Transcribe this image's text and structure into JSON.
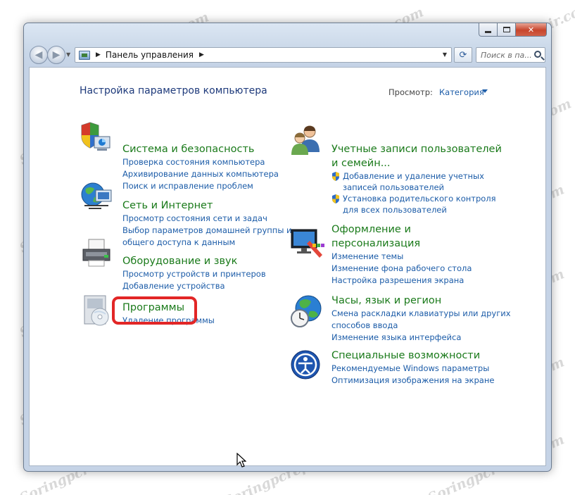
{
  "window": {
    "controls": {
      "minimize": "minimize",
      "maximize": "maximize",
      "close": "✕"
    }
  },
  "address": {
    "crumb": "Панель управления",
    "search_placeholder": "Поиск в па..."
  },
  "header": {
    "title": "Настройка параметров компьютера",
    "view_label": "Просмотр:",
    "view_value": "Категория"
  },
  "left": [
    {
      "title": "Система и безопасность",
      "icon": "shield-computer-icon",
      "links": [
        "Проверка состояния компьютера",
        "Архивирование данных компьютера",
        "Поиск и исправление проблем"
      ]
    },
    {
      "title": "Сеть и Интернет",
      "icon": "network-globe-icon",
      "links": [
        "Просмотр состояния сети и задач",
        "Выбор параметров домашней группы и",
        "общего доступа к данным"
      ]
    },
    {
      "title": "Оборудование и звук",
      "icon": "printer-icon",
      "links": [
        "Просмотр устройств и принтеров",
        "Добавление устройства"
      ]
    },
    {
      "title": "Программы",
      "icon": "programs-disc-icon",
      "links": [
        "Удаление программы"
      ]
    }
  ],
  "right": [
    {
      "title_lines": [
        "Учетные записи пользователей",
        "и семейн..."
      ],
      "icon": "users-icon",
      "shield_links": [
        [
          "Добавление и удаление учетных",
          "записей пользователей"
        ],
        [
          "Установка родительского контроля",
          "для всех пользователей"
        ]
      ]
    },
    {
      "title_lines": [
        "Оформление и",
        "персонализация"
      ],
      "icon": "personalization-monitor-icon",
      "links": [
        "Изменение темы",
        "Изменение фона рабочего стола",
        "Настройка разрешения экрана"
      ]
    },
    {
      "title_lines": [
        "Часы, язык и регион"
      ],
      "icon": "clock-globe-icon",
      "links": [
        "Смена раскладки клавиатуры или других",
        "способов ввода",
        "Изменение языка интерфейса"
      ]
    },
    {
      "title_lines": [
        "Специальные возможности"
      ],
      "icon": "accessibility-icon",
      "links": [
        "Рекомендуемые Windows параметры",
        "Оптимизация изображения на экране"
      ]
    }
  ],
  "watermark": "Soringpcrepair.com",
  "colors": {
    "title_green": "#1a7a1a",
    "link_blue": "#1c5ca8",
    "highlight_red": "#e22626"
  }
}
